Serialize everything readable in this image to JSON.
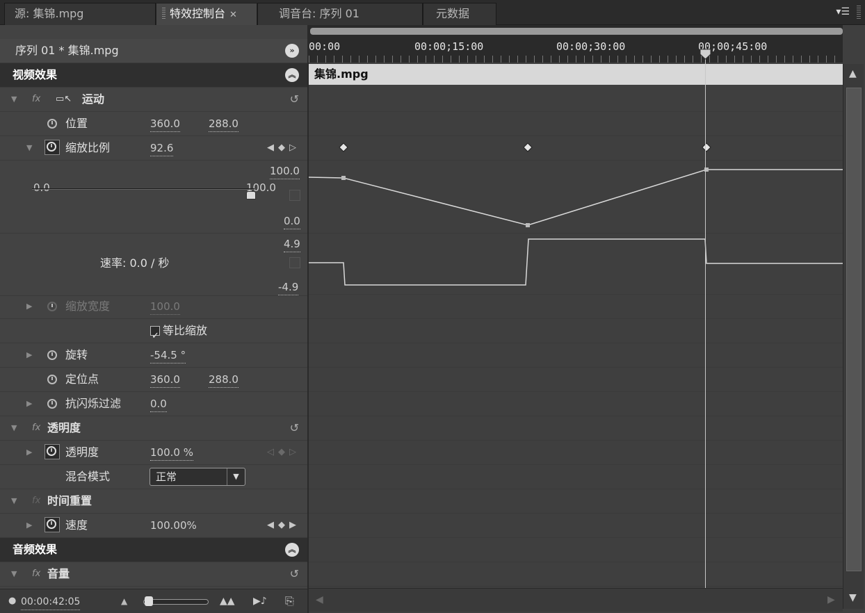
{
  "tabs": [
    {
      "label": "源: 集锦.mpg",
      "active": false
    },
    {
      "label": "特效控制台",
      "active": true
    },
    {
      "label": "调音台: 序列 01",
      "active": false
    },
    {
      "label": "元数据",
      "active": false
    }
  ],
  "sequence_clip": "序列 01 * 集锦.mpg",
  "video_effects": "视频效果",
  "motion": "运动",
  "position": {
    "label": "位置",
    "x": "360.0",
    "y": "288.0"
  },
  "scale": {
    "label": "缩放比例",
    "value": "92.6",
    "graph_max": "100.0",
    "graph_min": "0.0",
    "slider_min": "0.0",
    "slider_max": "100.0",
    "slider_value": 92.6
  },
  "velocity": {
    "label": "速率: 0.0 / 秒",
    "max": "4.9",
    "min": "-4.9"
  },
  "scale_width": {
    "label": "缩放宽度",
    "value": "100.0"
  },
  "uniform_scale": {
    "label": "等比缩放",
    "checked": true
  },
  "rotation": {
    "label": "旋转",
    "value": "-54.5 °"
  },
  "anchor": {
    "label": "定位点",
    "x": "360.0",
    "y": "288.0"
  },
  "antiflicker": {
    "label": "抗闪烁过滤",
    "value": "0.0"
  },
  "opacity_group": "透明度",
  "opacity": {
    "label": "透明度",
    "value": "100.0 %"
  },
  "blend": {
    "label": "混合模式",
    "value": "正常"
  },
  "time_remap": "时间重置",
  "speed": {
    "label": "速度",
    "value": "100.00%"
  },
  "audio_effects": "音频效果",
  "volume": "音量",
  "timecode": "00:00:42:05",
  "ruler": [
    "00:00",
    "00:00;15:00",
    "00:00;30:00",
    "00;00;45:00"
  ],
  "clip_name": "集锦.mpg",
  "colors": {
    "panel": "#434343",
    "graph_line": "#d9d9d9",
    "clip_bar": "#d8d8d8"
  }
}
